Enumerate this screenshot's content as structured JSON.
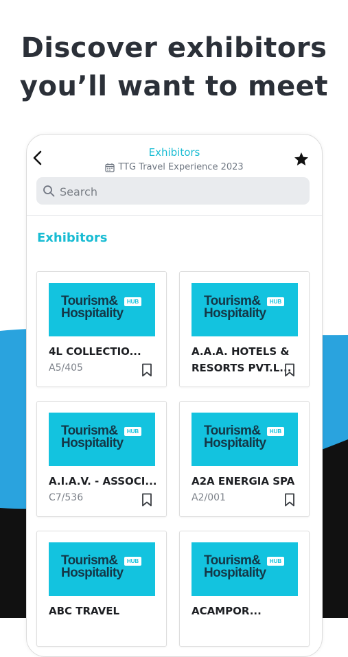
{
  "headline": {
    "line1": "Discover exhibitors",
    "line2": "you’ll want to meet"
  },
  "colors": {
    "accent": "#19bcd3",
    "background_band": "#2aa3de",
    "logo_bg": "#13c3df",
    "dark_band": "#111111"
  },
  "nav": {
    "title": "Exhibitors",
    "subtitle": "TTG Travel Experience 2023",
    "back_icon": "chevron-left-icon",
    "favorite_icon": "star-icon",
    "calendar_icon": "calendar-icon"
  },
  "search": {
    "placeholder": "Search",
    "value": ""
  },
  "section_title": "Exhibitors",
  "exhibitors": [
    {
      "logo_line1": "Tourism&",
      "logo_line2": "Hospitality",
      "logo_badge": "HUB",
      "name": "4L COLLECTIO...",
      "booth": "A5/405"
    },
    {
      "logo_line1": "Tourism&",
      "logo_line2": "Hospitality",
      "logo_badge": "HUB",
      "name_line1": "A.A.A. HOTELS &",
      "name_line2": "RESORTS PVT.L...",
      "booth": ""
    },
    {
      "logo_line1": "Tourism&",
      "logo_line2": "Hospitality",
      "logo_badge": "HUB",
      "name": "A.I.A.V. - ASSOCI...",
      "booth": "C7/536"
    },
    {
      "logo_line1": "Tourism&",
      "logo_line2": "Hospitality",
      "logo_badge": "HUB",
      "name": "A2A ENERGIA SPA",
      "booth": "A2/001"
    },
    {
      "logo_line1": "Tourism&",
      "logo_line2": "Hospitality",
      "logo_badge": "HUB",
      "name": "ABC TRAVEL",
      "booth": ""
    },
    {
      "logo_line1": "Tourism&",
      "logo_line2": "Hospitality",
      "logo_badge": "HUB",
      "name": "ACAMPOR...",
      "booth": ""
    }
  ]
}
